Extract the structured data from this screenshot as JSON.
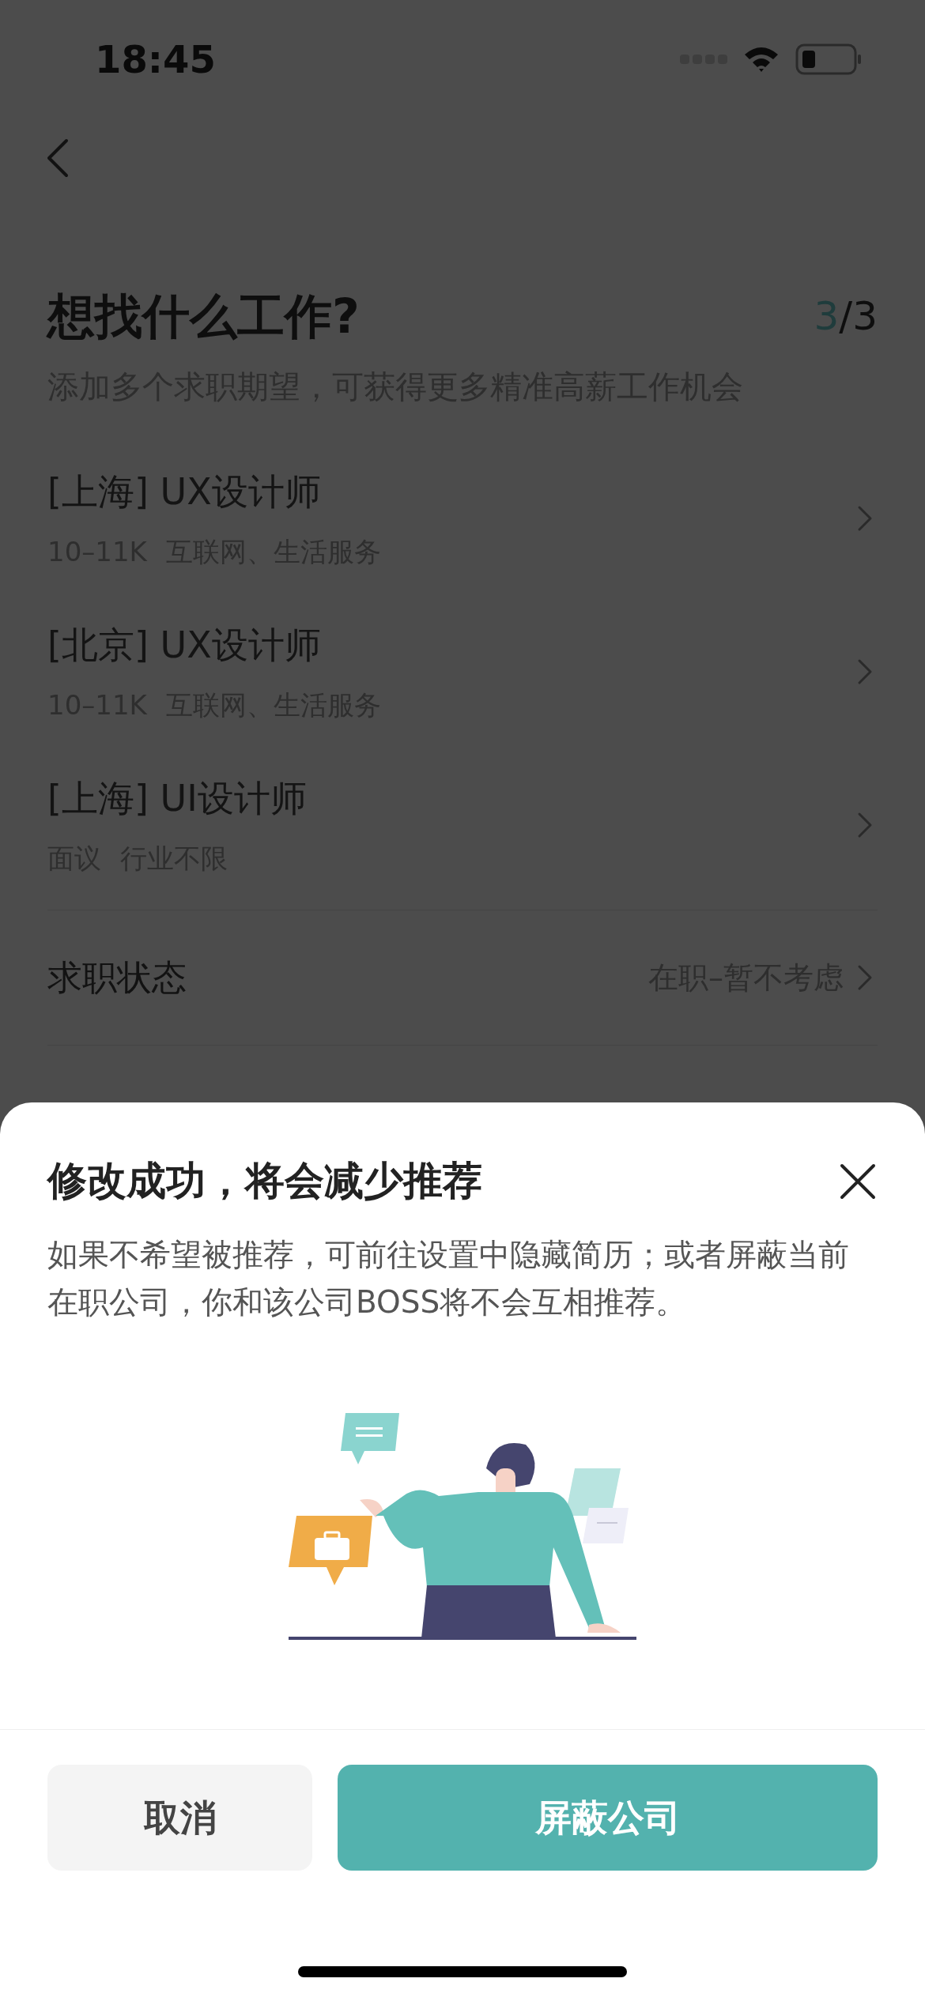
{
  "status_bar": {
    "time": "18:45"
  },
  "header": {
    "title": "想找什么工作?",
    "progress_current": "3",
    "progress_total": "/3",
    "subtitle": "添加多个求职期望，可获得更多精准高薪工作机会"
  },
  "expectations": [
    {
      "title": "[上海] UX设计师",
      "details": [
        "10–11K",
        "互联网、生活服务"
      ]
    },
    {
      "title": "[北京] UX设计师",
      "details": [
        "10–11K",
        "互联网、生活服务"
      ]
    },
    {
      "title": "[上海] UI设计师",
      "details": [
        "面议",
        "行业不限"
      ]
    }
  ],
  "job_status": {
    "label": "求职状态",
    "value": "在职–暂不考虑"
  },
  "sheet": {
    "title": "修改成功，将会减少推荐",
    "body": "如果不希望被推荐，可前往设置中隐藏简历；或者屏蔽当前在职公司，你和该公司BOSS将不会互相推荐。",
    "buttons": [
      {
        "label": "取消",
        "kind": "secondary"
      },
      {
        "label": "屏蔽公司",
        "kind": "primary"
      }
    ]
  }
}
